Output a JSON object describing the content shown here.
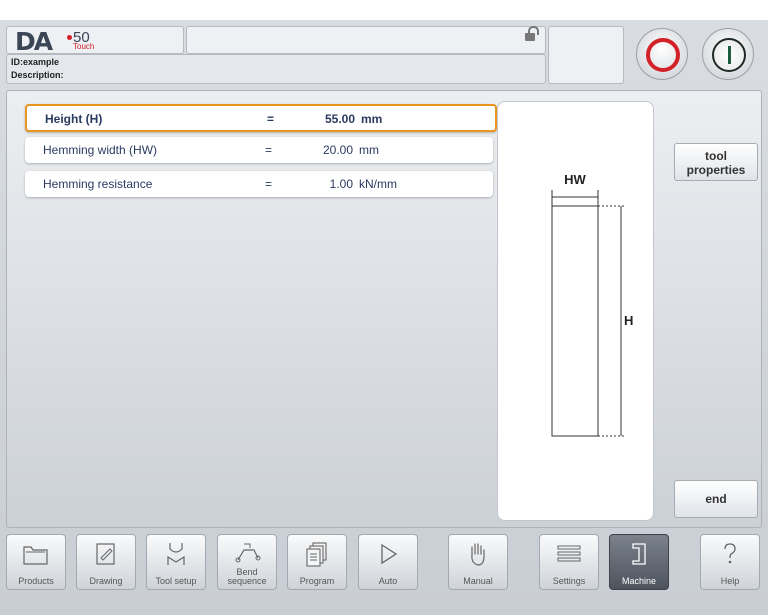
{
  "logo": {
    "brand": "DA",
    "model": "50",
    "sub": "Touch"
  },
  "info": {
    "id_line": "ID:example",
    "description_line": "Description:"
  },
  "params": [
    {
      "label": "Height (H)",
      "eq": "=",
      "value": "55.00",
      "unit": "mm",
      "selected": true
    },
    {
      "label": "Hemming width (HW)",
      "eq": "=",
      "value": "20.00",
      "unit": "mm",
      "selected": false
    },
    {
      "label": "Hemming resistance",
      "eq": "=",
      "value": "1.00",
      "unit": "kN/mm",
      "selected": false
    }
  ],
  "drawing": {
    "hw_label": "HW",
    "h_label": "H"
  },
  "side": {
    "tool_properties_1": "tool",
    "tool_properties_2": "properties",
    "end": "end"
  },
  "nav": [
    {
      "label": "Products",
      "icon": "folder-icon"
    },
    {
      "label": "Drawing",
      "icon": "pencil-icon"
    },
    {
      "label": "Tool setup",
      "icon": "tool-setup-icon"
    },
    {
      "label": "Bend",
      "label2": "sequence",
      "icon": "bend-sequence-icon"
    },
    {
      "label": "Program",
      "icon": "pages-icon"
    },
    {
      "label": "Auto",
      "icon": "play-icon"
    },
    {
      "label": "Manual",
      "icon": "hand-icon"
    },
    {
      "label": "Settings",
      "icon": "list-icon"
    },
    {
      "label": "Machine",
      "icon": "machine-icon",
      "active": true
    },
    {
      "label": "Help",
      "icon": "question-icon"
    }
  ],
  "colors": {
    "accent_orange": "#e8951e",
    "stop_red": "#d32128",
    "start_green": "#1f5c3c"
  }
}
